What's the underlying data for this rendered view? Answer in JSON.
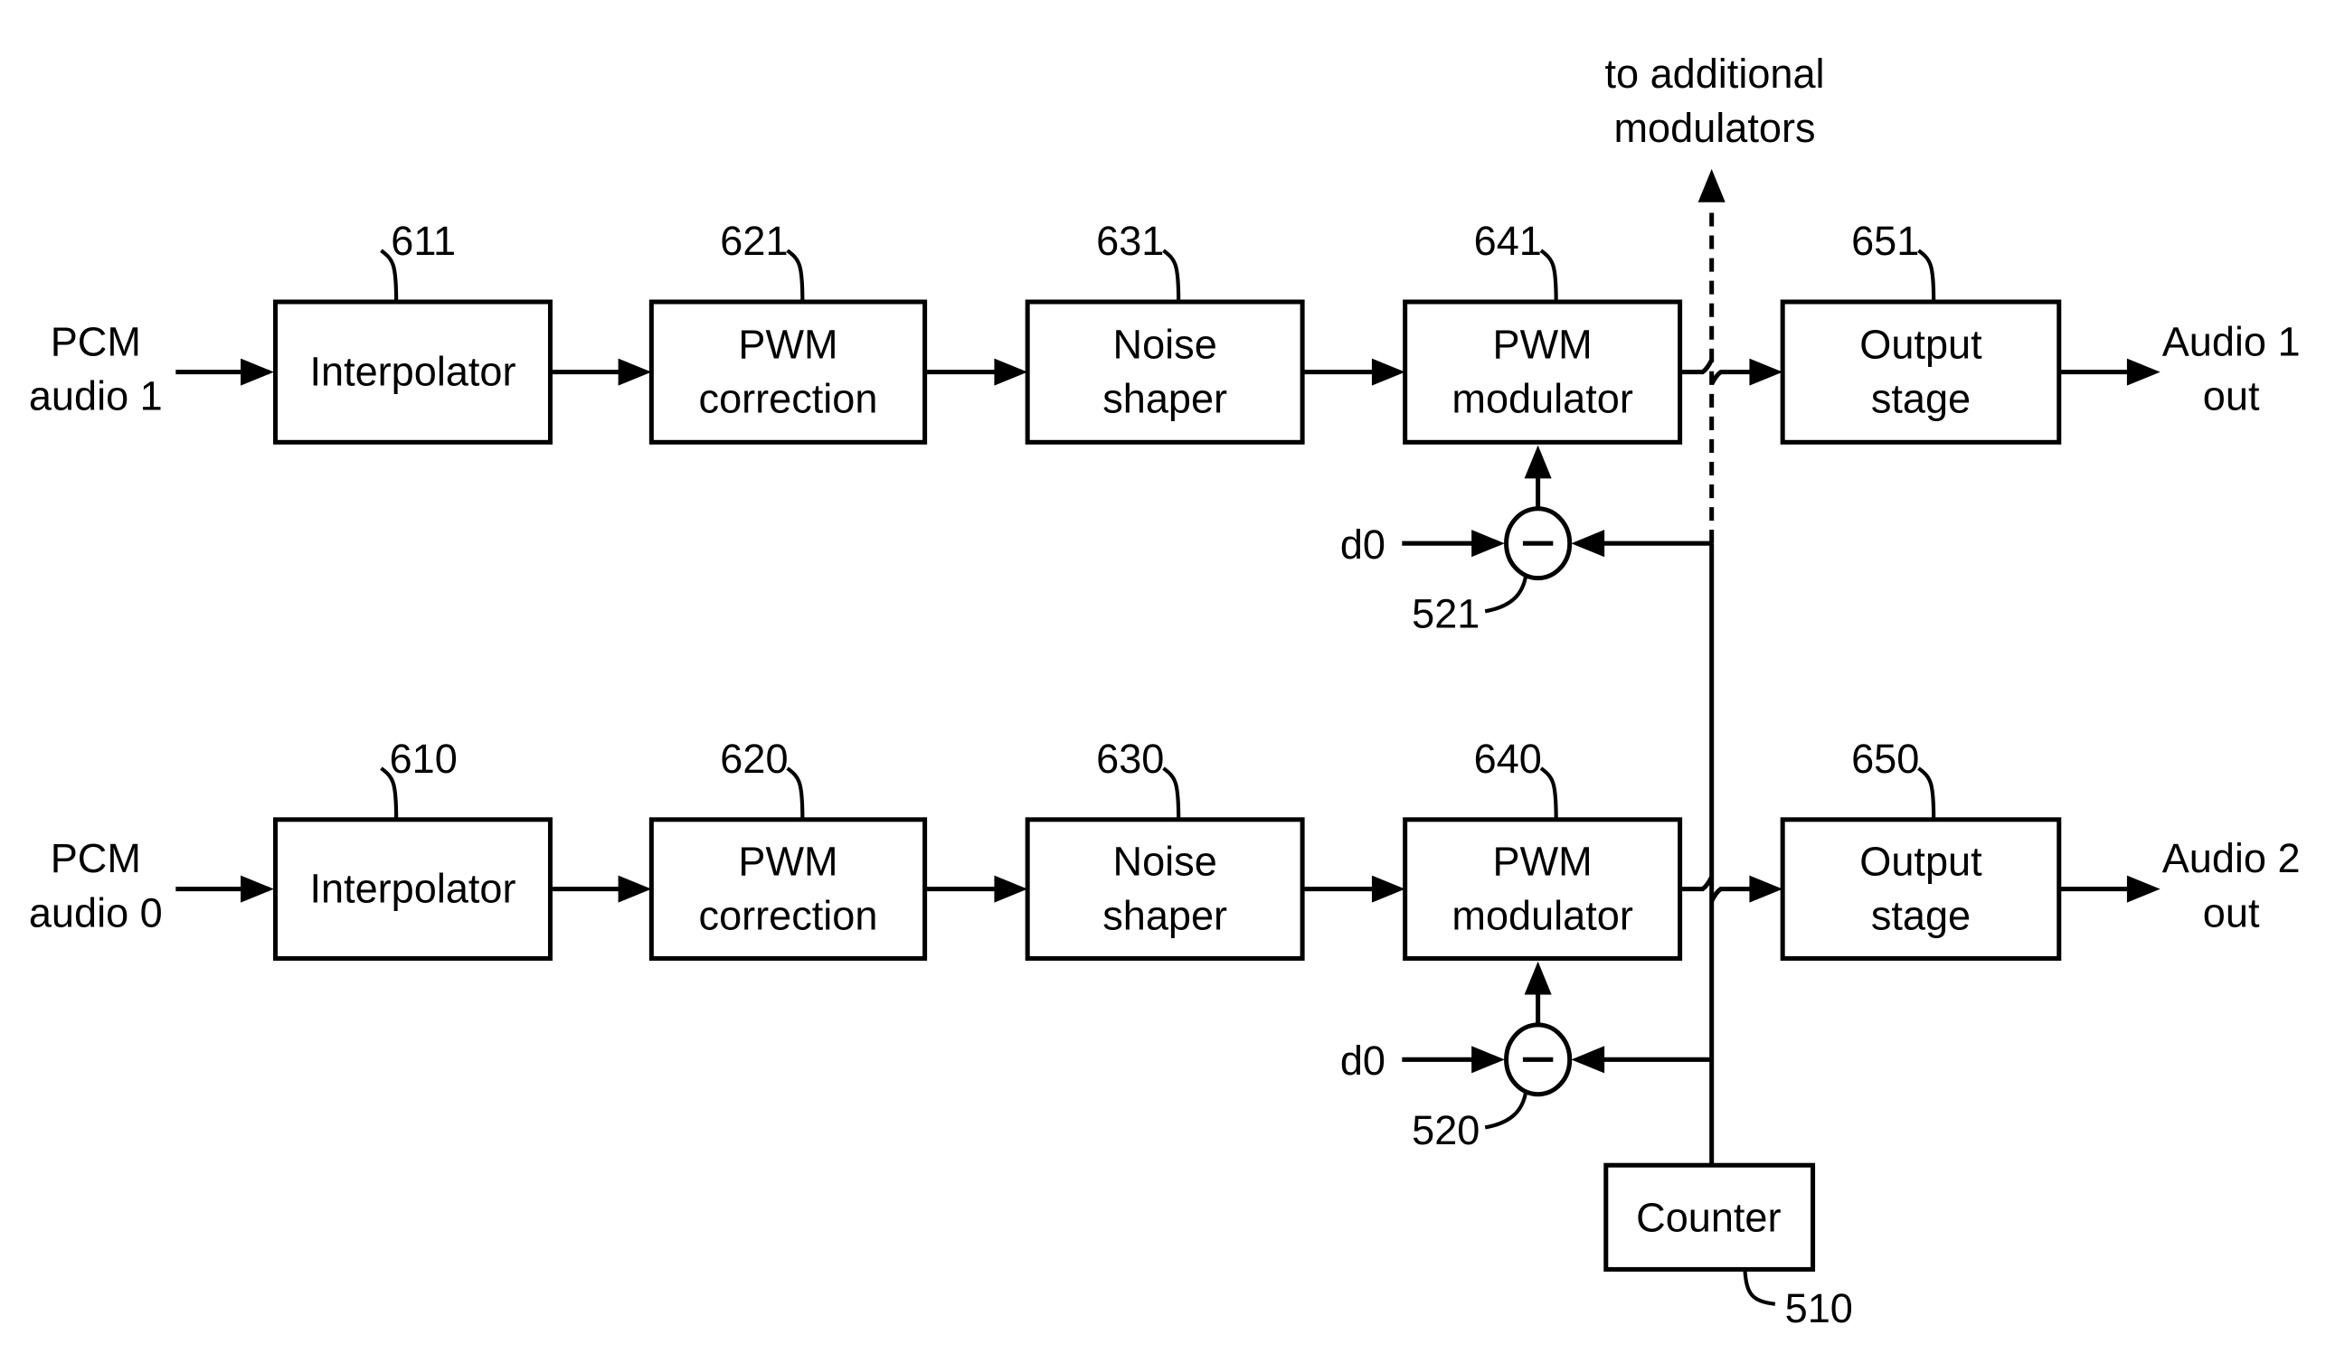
{
  "diagram": {
    "rows": [
      {
        "input_label": [
          "PCM",
          "audio 1"
        ],
        "output_label": [
          "Audio 1",
          "out"
        ],
        "blocks": [
          {
            "ref": "611",
            "label": [
              "Interpolator"
            ]
          },
          {
            "ref": "621",
            "label": [
              "PWM",
              "correction"
            ]
          },
          {
            "ref": "631",
            "label": [
              "Noise",
              "shaper"
            ]
          },
          {
            "ref": "641",
            "label": [
              "PWM",
              "modulator"
            ]
          },
          {
            "ref": "651",
            "label": [
              "Output",
              "stage"
            ]
          }
        ],
        "subtractor": {
          "ref": "521",
          "symbol": "−",
          "input_label": "d0"
        }
      },
      {
        "input_label": [
          "PCM",
          "audio 0"
        ],
        "output_label": [
          "Audio 2",
          "out"
        ],
        "blocks": [
          {
            "ref": "610",
            "label": [
              "Interpolator"
            ]
          },
          {
            "ref": "620",
            "label": [
              "PWM",
              "correction"
            ]
          },
          {
            "ref": "630",
            "label": [
              "Noise",
              "shaper"
            ]
          },
          {
            "ref": "640",
            "label": [
              "PWM",
              "modulator"
            ]
          },
          {
            "ref": "650",
            "label": [
              "Output",
              "stage"
            ]
          }
        ],
        "subtractor": {
          "ref": "520",
          "symbol": "−",
          "input_label": "d0"
        }
      }
    ],
    "counter": {
      "ref": "510",
      "label": "Counter"
    },
    "extension_label": [
      "to additional",
      "modulators"
    ]
  }
}
